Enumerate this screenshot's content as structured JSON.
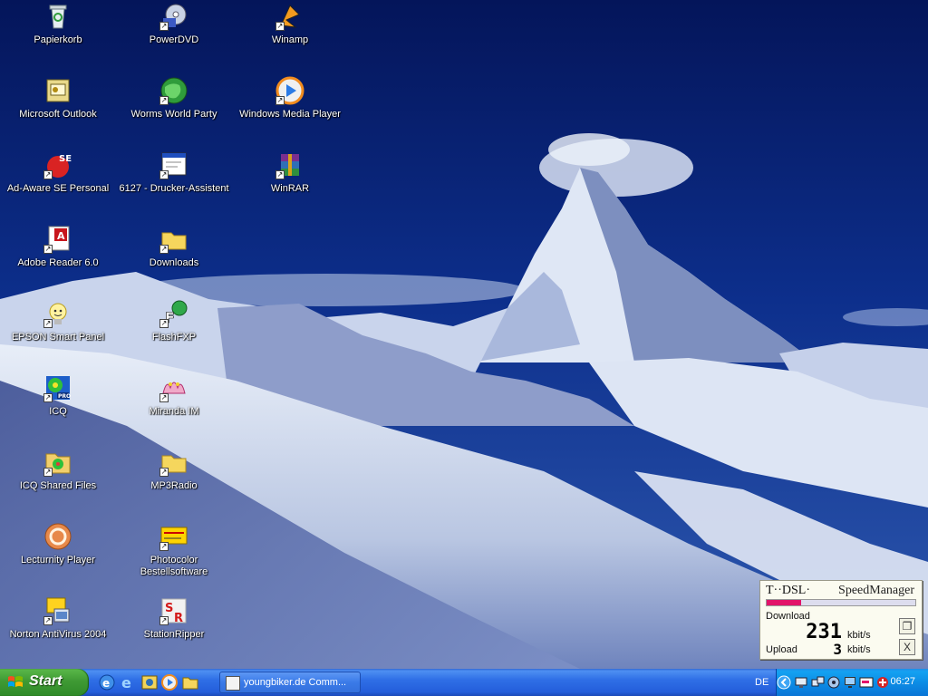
{
  "desktop": {
    "icons": [
      {
        "label": "Papierkorb",
        "icon": "recycle-bin-icon"
      },
      {
        "label": "PowerDVD",
        "icon": "powerdvd-icon"
      },
      {
        "label": "Winamp",
        "icon": "winamp-icon"
      },
      {
        "label": "Microsoft Outlook",
        "icon": "outlook-icon"
      },
      {
        "label": "Worms World Party",
        "icon": "globe-icon"
      },
      {
        "label": "Windows Media Player",
        "icon": "media-player-icon"
      },
      {
        "label": "Ad-Aware SE Personal",
        "icon": "adaware-icon"
      },
      {
        "label": "6127 - Drucker-Assistent",
        "icon": "printer-assistant-icon"
      },
      {
        "label": "WinRAR",
        "icon": "winrar-icon"
      },
      {
        "label": "Adobe Reader 6.0",
        "icon": "adobe-reader-icon"
      },
      {
        "label": "Downloads",
        "icon": "folder-icon"
      },
      {
        "label": "EPSON Smart Panel",
        "icon": "lightbulb-icon"
      },
      {
        "label": "FlashFXP",
        "icon": "flashfxp-icon"
      },
      {
        "label": "ICQ",
        "icon": "icq-icon"
      },
      {
        "label": "Miranda IM",
        "icon": "miranda-icon"
      },
      {
        "label": "ICQ Shared Files",
        "icon": "icq-folder-icon"
      },
      {
        "label": "MP3Radio",
        "icon": "folder-icon"
      },
      {
        "label": "Lecturnity Player",
        "icon": "lecturnity-icon"
      },
      {
        "label": "Photocolor Bestellsoftware",
        "icon": "photocolor-icon"
      },
      {
        "label": "Norton AntiVirus 2004",
        "icon": "norton-icon"
      },
      {
        "label": "StationRipper",
        "icon": "stationripper-icon"
      }
    ]
  },
  "speed_manager": {
    "brand": "T··DSL·",
    "title": "SpeedManager",
    "download_label": "Download",
    "download_value": "231",
    "download_unit": "kbit/s",
    "upload_label": "Upload",
    "upload_value": "3",
    "upload_unit": "kbit/s",
    "download_bar_fraction": 0.23,
    "close_glyph": "X"
  },
  "taskbar": {
    "start_label": "Start",
    "quick_launch": [
      "ie-icon",
      "internet-explorer-icon",
      "outlook-express-icon",
      "media-player-icon",
      "folder-icon"
    ],
    "tasks": [
      {
        "label": "youngbiker.de Comm..."
      }
    ],
    "language": "DE",
    "clock": "06:27"
  },
  "colors": {
    "taskbar_blue": "#245edb",
    "start_green": "#3f9a34",
    "tray_blue": "#0c8de6",
    "tdsl_magenta": "#e2136a"
  }
}
